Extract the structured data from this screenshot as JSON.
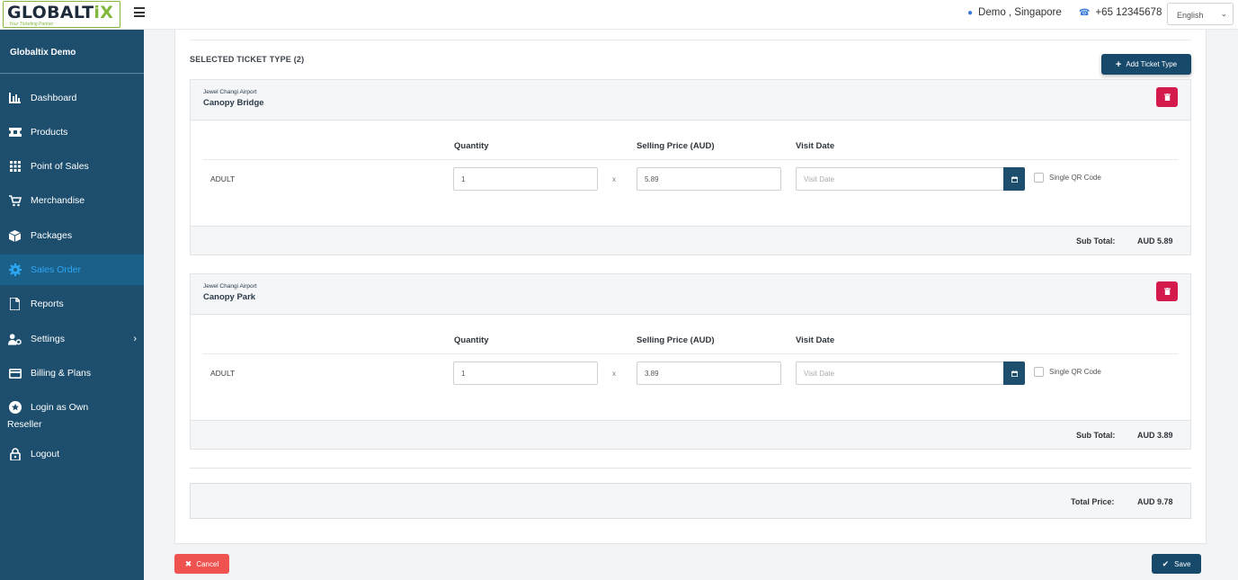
{
  "header": {
    "logo_text_main": "GLOBALT",
    "logo_text_accent": "iX",
    "logo_tagline": "Your Ticketing Partner",
    "user": "Demo , Singapore",
    "phone": "+65 12345678",
    "language": "English"
  },
  "sidebar": {
    "brand": "Globaltix Demo",
    "items": [
      {
        "label": "Dashboard"
      },
      {
        "label": "Products"
      },
      {
        "label": "Point of Sales"
      },
      {
        "label": "Merchandise"
      },
      {
        "label": "Packages"
      },
      {
        "label": "Sales Order"
      },
      {
        "label": "Reports"
      },
      {
        "label": "Settings"
      },
      {
        "label": "Billing & Plans"
      },
      {
        "label": "Login as Own"
      },
      {
        "label": "Logout"
      }
    ],
    "login_second_line": "Reseller"
  },
  "main": {
    "section_title": "SELECTED TICKET TYPE (2)",
    "add_button": "Add Ticket Type",
    "columns": {
      "quantity": "Quantity",
      "price": "Selling Price (AUD)",
      "date": "Visit Date"
    },
    "tickets": [
      {
        "venue": "Jewel Changi Airport",
        "name": "Canopy Bridge",
        "type": "ADULT",
        "quantity": "1",
        "times": "x",
        "price": "5.89",
        "date_placeholder": "Visit Date",
        "qr_label": "Single QR Code",
        "subtotal_label": "Sub Total:",
        "subtotal_value": "AUD 5.89"
      },
      {
        "venue": "Jewel Changi Airport",
        "name": "Canopy Park",
        "type": "ADULT",
        "quantity": "1",
        "times": "x",
        "price": "3.89",
        "date_placeholder": "Visit Date",
        "qr_label": "Single QR Code",
        "subtotal_label": "Sub Total:",
        "subtotal_value": "AUD 3.89"
      }
    ],
    "total_label": "Total Price:",
    "total_value": "AUD 9.78",
    "cancel_button": "Cancel",
    "save_button": "Save"
  },
  "colors": {
    "sidebar_bg": "#1d4e6e",
    "active_text": "#2ea6f2",
    "primary_button": "#17496a",
    "delete_button": "#d41a4c",
    "cancel_button": "#f0524f",
    "logo_accent": "#7fb83a"
  }
}
